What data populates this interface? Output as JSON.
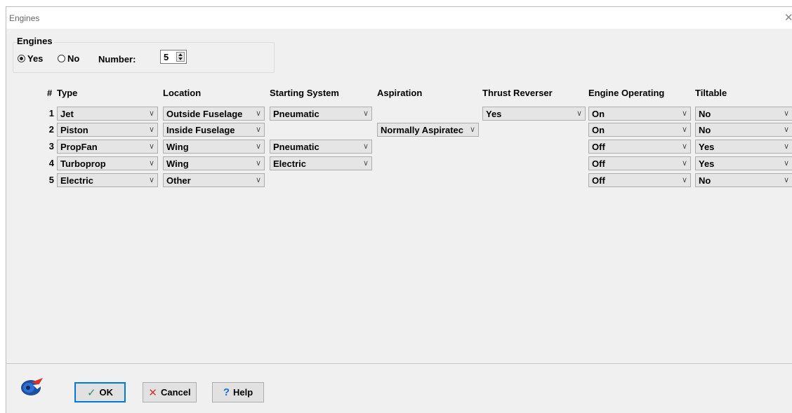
{
  "window": {
    "title": "Engines",
    "close_glyph": "✕"
  },
  "engines_group": {
    "label": "Engines",
    "yes_label": "Yes",
    "no_label": "No",
    "selected": "Yes",
    "number_label": "Number:",
    "number_value": "5"
  },
  "columns": [
    "#",
    "Type",
    "Location",
    "Starting System",
    "Aspiration",
    "Thrust Reverser",
    "Engine Operating",
    "Tiltable"
  ],
  "rows": [
    {
      "num": "1",
      "type": "Jet",
      "location": "Outside Fuselage",
      "starting": "Pneumatic",
      "aspiration": null,
      "thrust": "Yes",
      "operating": "On",
      "tiltable": "No"
    },
    {
      "num": "2",
      "type": "Piston",
      "location": "Inside Fuselage",
      "starting": null,
      "aspiration": "Normally Aspiratec",
      "thrust": null,
      "operating": "On",
      "tiltable": "No"
    },
    {
      "num": "3",
      "type": "PropFan",
      "location": "Wing",
      "starting": "Pneumatic",
      "aspiration": null,
      "thrust": null,
      "operating": "Off",
      "tiltable": "Yes"
    },
    {
      "num": "4",
      "type": "Turboprop",
      "location": "Wing",
      "starting": "Electric",
      "aspiration": null,
      "thrust": null,
      "operating": "Off",
      "tiltable": "Yes"
    },
    {
      "num": "5",
      "type": "Electric",
      "location": "Other",
      "starting": null,
      "aspiration": null,
      "thrust": null,
      "operating": "Off",
      "tiltable": "No"
    }
  ],
  "buttons": {
    "ok": "OK",
    "cancel": "Cancel",
    "help": "Help"
  },
  "icons": {
    "ok": "check-icon",
    "cancel": "x-icon",
    "help": "question-icon",
    "logo": "app-logo-icon"
  },
  "colors": {
    "ok_check": "#2e8b57",
    "cancel_x": "#d9342b",
    "help_q": "#1e6fd1",
    "default_border": "#0078d7"
  }
}
